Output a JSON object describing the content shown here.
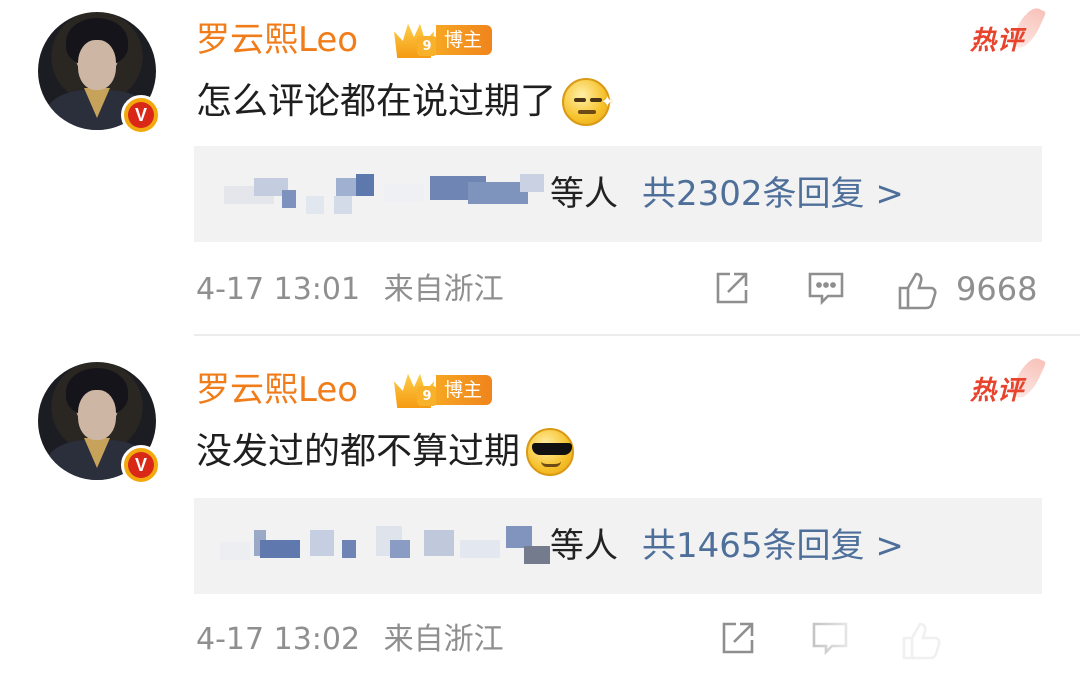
{
  "comments": [
    {
      "author": "罗云熙Leo",
      "badge_number": "9",
      "badge_label": "博主",
      "hot_label": "热评",
      "text": "怎么评论都在说过期了",
      "emoji": "smirk-emoji",
      "reply_suffix": "等人",
      "reply_link": "共2302条回复 >",
      "time": "4-17 13:01",
      "location": "来自浙江",
      "likes": "9668"
    },
    {
      "author": "罗云熙Leo",
      "badge_number": "9",
      "badge_label": "博主",
      "hot_label": "热评",
      "text": "没发过的都不算过期",
      "emoji": "sunglasses-emoji",
      "reply_suffix": "等人",
      "reply_link": "共1465条回复 >",
      "time": "4-17 13:02",
      "location": "来自浙江",
      "likes": ""
    }
  ],
  "verified_mark": "V",
  "colors": {
    "author": "#f07d1a",
    "link": "#4e6f99",
    "meta": "#8f8f8f",
    "reply_bg": "#f2f2f2",
    "hot": "#e8442d"
  },
  "icons": [
    "share-icon",
    "comment-icon",
    "like-icon",
    "crown-icon"
  ]
}
